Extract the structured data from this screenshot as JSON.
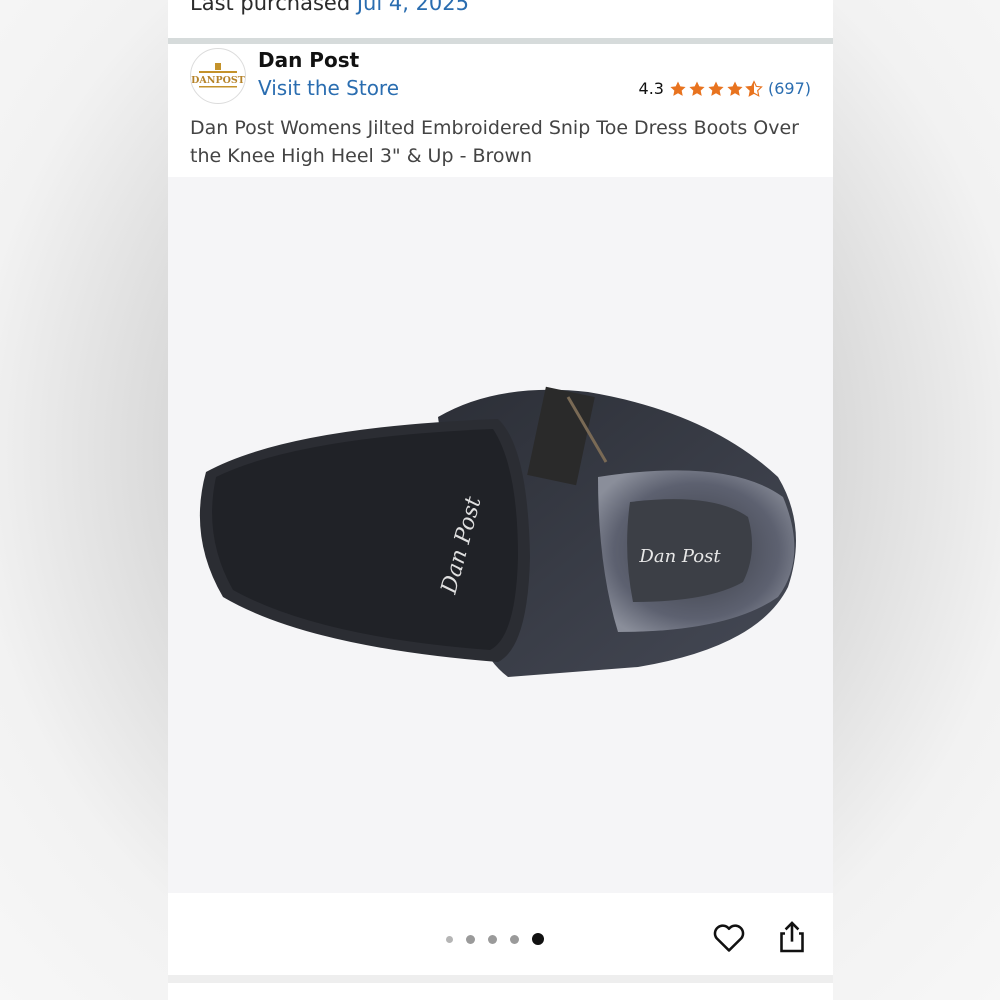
{
  "header": {
    "last_purchased_label": "Last purchased",
    "last_purchased_date": "Jul 4, 2025"
  },
  "brand": {
    "logo_text": "DANPOST",
    "name": "Dan Post",
    "visit_store_label": "Visit the Store"
  },
  "rating": {
    "value": "4.3",
    "count": "(697)",
    "stars_icon": "star-rating-icons",
    "star_color": "#e8731f"
  },
  "product": {
    "title": "Dan Post Womens Jilted Embroidered Snip Toe Dress Boots Over the Knee High Heel 3\" & Up - Brown",
    "image_desc_icon": "boot-sole-image"
  },
  "carousel": {
    "dot_count": 5,
    "active_index": 4
  },
  "actions": {
    "favorite_icon": "heart-icon",
    "share_icon": "share-icon"
  },
  "colors": {
    "link": "#2a6db0",
    "text": "#111111"
  }
}
